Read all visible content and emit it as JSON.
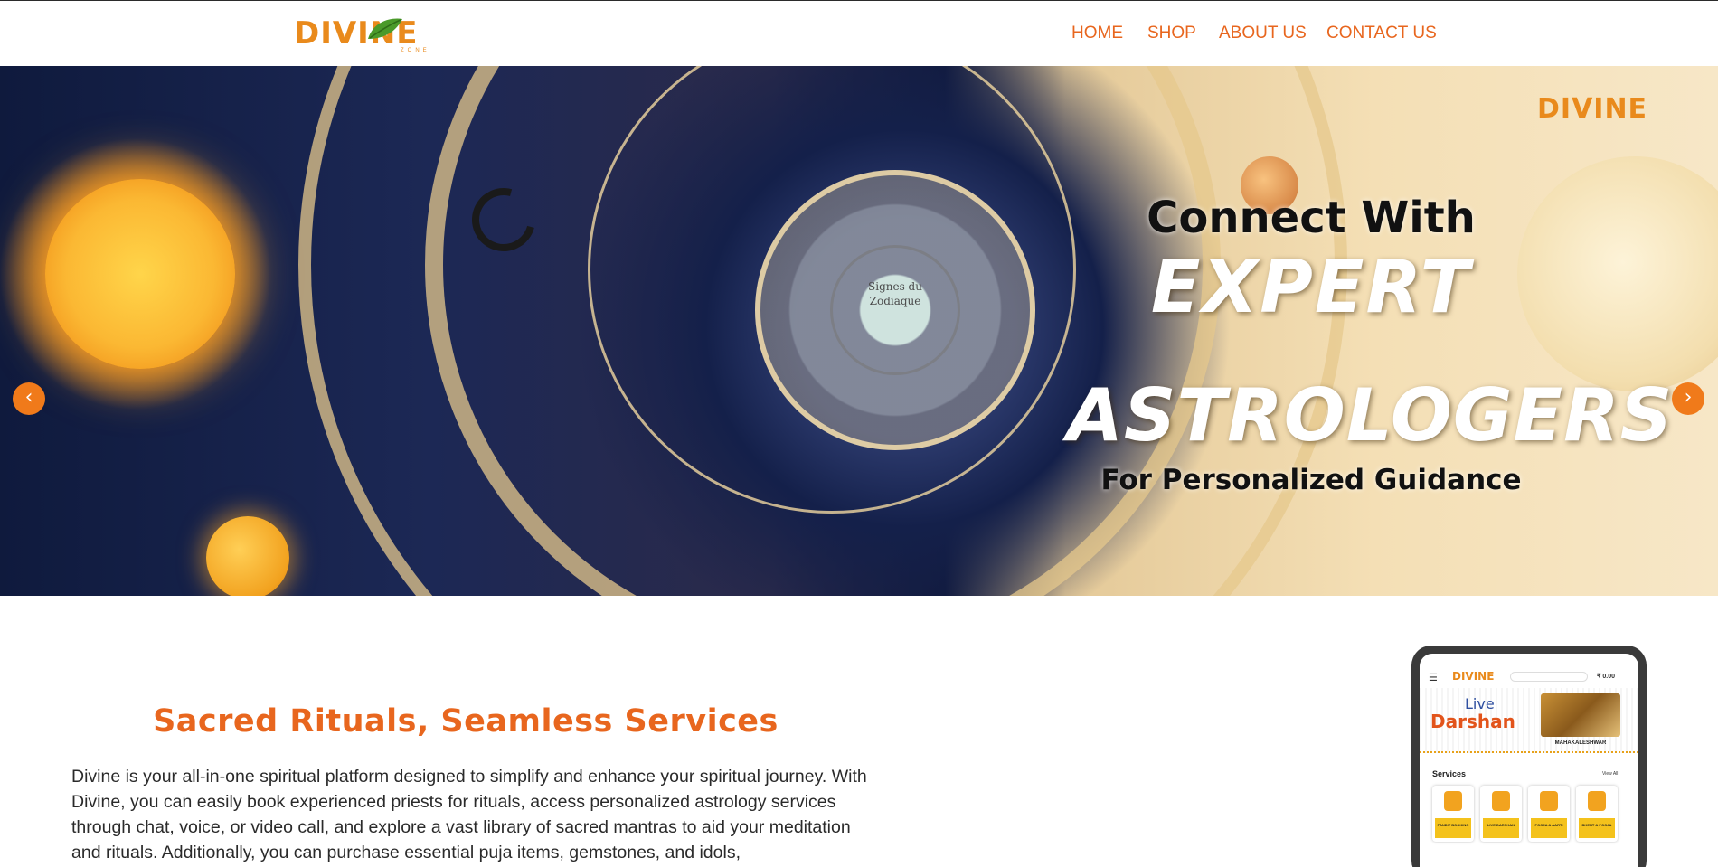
{
  "header": {
    "logo_text": "DIVINE",
    "logo_sub": "ZONE",
    "nav": [
      {
        "label": "HOME"
      },
      {
        "label": "SHOP"
      },
      {
        "label": "ABOUT US"
      },
      {
        "label": "CONTACT US"
      }
    ],
    "colors": {
      "brand": "#e98a1c",
      "nav": "#e8661e"
    }
  },
  "hero": {
    "logo_text": "DIVINE",
    "dial_text": "Signes du Zodiaque",
    "line1": "Connect With",
    "line2": "EXPERT",
    "line3": "ASTROLOGERS",
    "line4": "For Personalized Guidance",
    "prev_icon": "‹",
    "next_icon": "›",
    "arrow_color": "#f07a1a"
  },
  "about": {
    "title": "Sacred Rituals, Seamless Services",
    "body": "Divine is your all-in-one spiritual platform designed to simplify and enhance your spiritual journey. With Divine, you can easily book experienced priests for rituals, access personalized astrology services through chat, voice, or video call, and explore a vast library of sacred mantras to aid your meditation and rituals. Additionally, you can purchase essential puja items, gemstones, and idols,"
  },
  "phone": {
    "logo": "DIVINE",
    "cart": "₹ 0.00",
    "live": "Live",
    "darshan": "Darshan",
    "temple": "MAHAKALESHWAR",
    "services_title": "Services",
    "view_all": "View All",
    "services": [
      {
        "label": "PANDIT BOOKING"
      },
      {
        "label": "LIVE DARSHAN"
      },
      {
        "label": "POOJA & AARTI"
      },
      {
        "label": "BHENT & POOJA"
      }
    ]
  }
}
